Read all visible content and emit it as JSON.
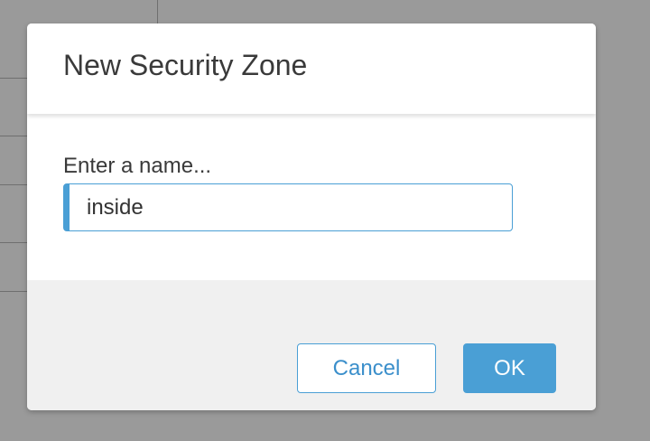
{
  "dialog": {
    "title": "New Security Zone",
    "name_label": "Enter a name...",
    "name_value": "inside",
    "cancel_label": "Cancel",
    "ok_label": "OK"
  },
  "colors": {
    "accent": "#4a9fd5",
    "backdrop": "#9a9a9a",
    "footer": "#f0f0f0"
  }
}
